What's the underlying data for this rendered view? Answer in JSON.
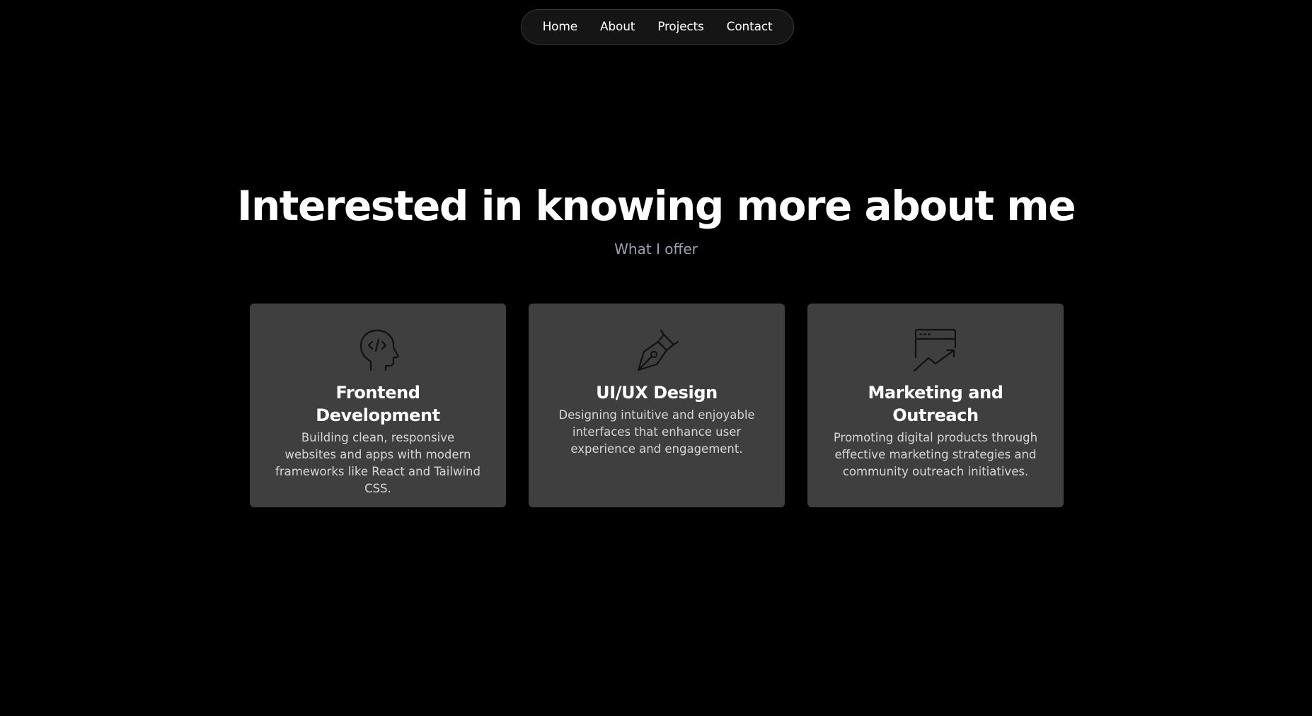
{
  "nav": {
    "items": [
      {
        "label": "Home"
      },
      {
        "label": "About"
      },
      {
        "label": "Projects"
      },
      {
        "label": "Contact"
      }
    ]
  },
  "hero": {
    "title": "Interested in knowing more about me",
    "subtitle": "What I offer"
  },
  "cards": [
    {
      "icon": "code-head-icon",
      "title": "Frontend Development",
      "description": "Building clean, responsive websites and apps with modern frameworks like React and Tailwind CSS."
    },
    {
      "icon": "pen-nib-icon",
      "title": "UI/UX Design",
      "description": "Designing intuitive and enjoyable interfaces that enhance user experience and engagement."
    },
    {
      "icon": "browser-growth-icon",
      "title": "Marketing and Outreach",
      "description": "Promoting digital products through effective marketing strategies and community outreach initiatives."
    }
  ],
  "colors": {
    "background": "#000000",
    "card": "#403f40",
    "subtitle": "#9aa1b3",
    "icon": "#111111"
  }
}
